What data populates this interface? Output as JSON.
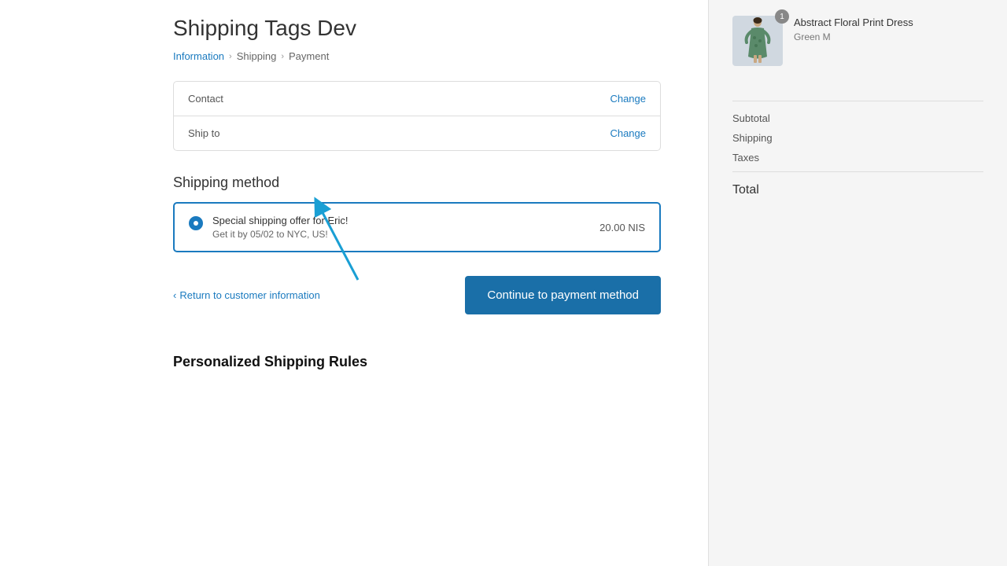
{
  "page": {
    "title": "Shipping Tags Dev"
  },
  "breadcrumb": {
    "items": [
      {
        "label": "Information",
        "active": true
      },
      {
        "label": "Shipping",
        "active": false
      },
      {
        "label": "Payment",
        "active": false
      }
    ]
  },
  "info_card": {
    "contact_label": "Contact",
    "contact_change": "Change",
    "ship_to_label": "Ship to",
    "ship_to_change": "Change"
  },
  "shipping_method": {
    "title": "Shipping method",
    "options": [
      {
        "name": "Special shipping offer for Eric!",
        "detail": "Get it by 05/02 to NYC, US!",
        "price": "20.00 NIS",
        "selected": true
      }
    ]
  },
  "actions": {
    "return_label": "Return to customer information",
    "continue_label": "Continue to payment method"
  },
  "annotation": {
    "label": "Personalized Shipping Rules"
  },
  "sidebar": {
    "product": {
      "name": "Abstract Floral Print Dress",
      "variant": "Green M",
      "badge": "1"
    },
    "subtotal_label": "Subtotal",
    "shipping_label": "Shipping",
    "taxes_label": "Taxes",
    "total_label": "Total",
    "subtotal_value": "",
    "shipping_value": "",
    "taxes_value": "",
    "total_value": ""
  }
}
